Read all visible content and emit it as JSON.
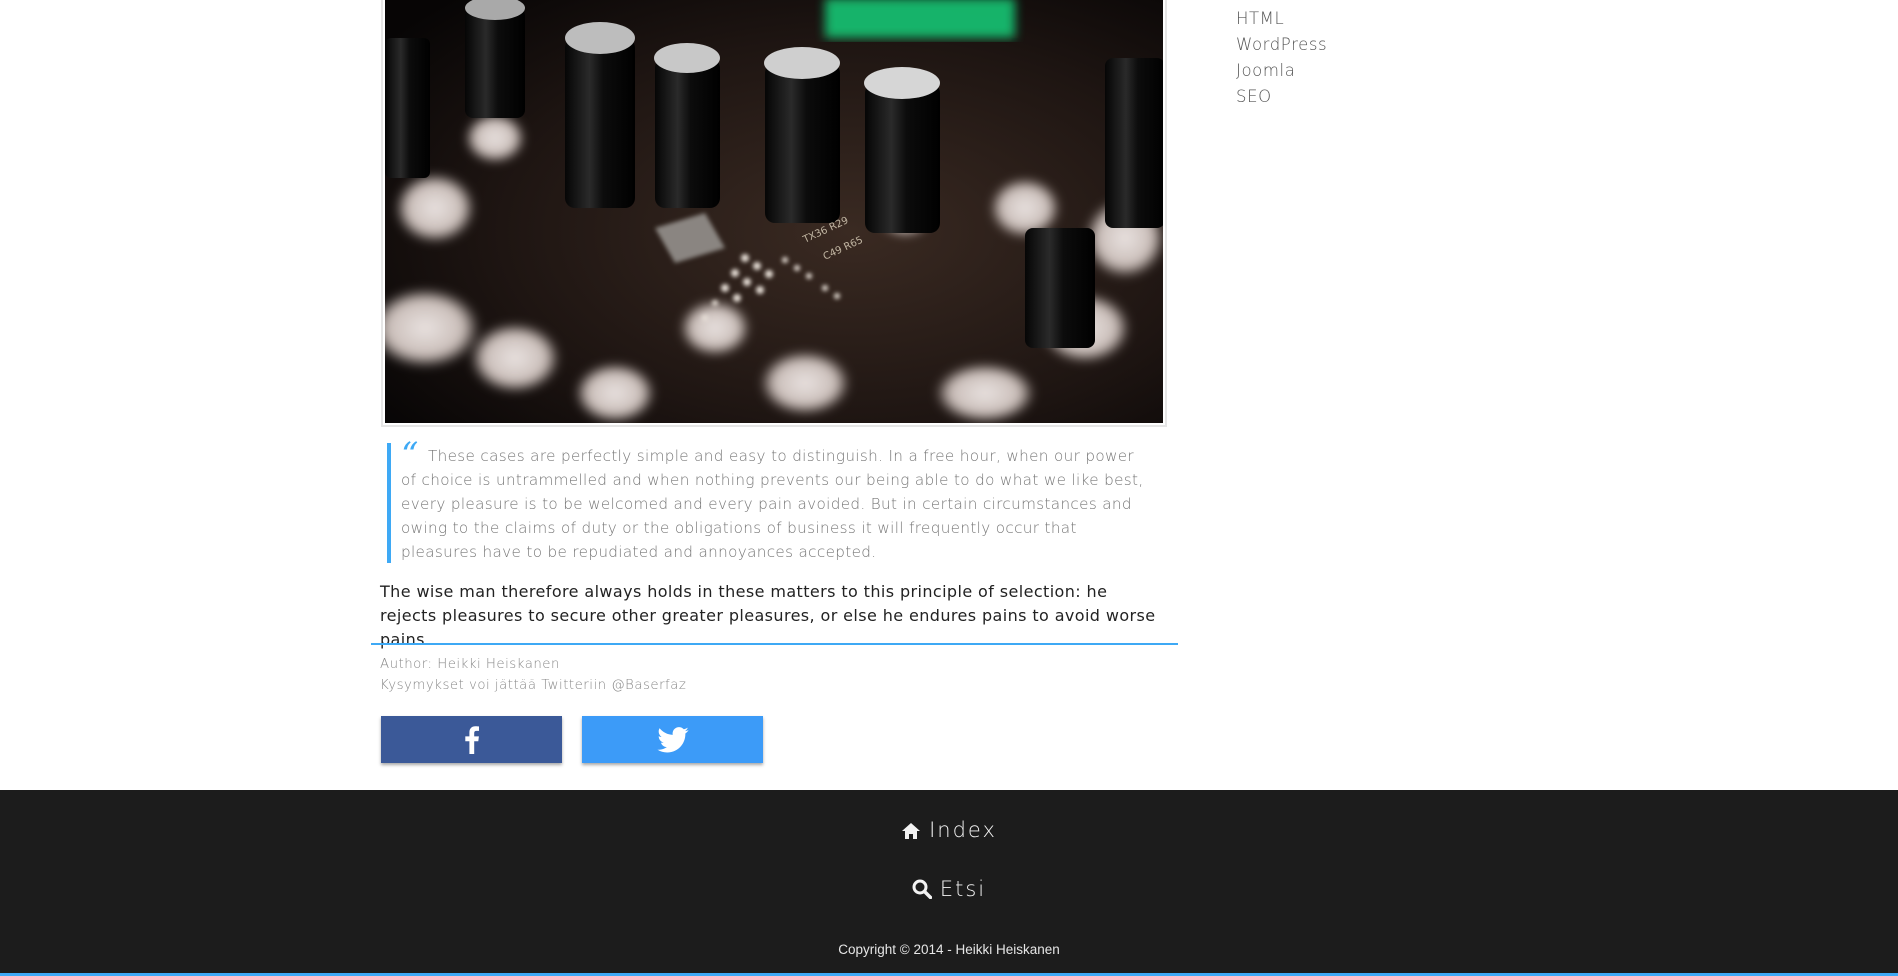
{
  "hero_image": {
    "subject": "circuit-board-photo"
  },
  "sidebar": {
    "links": [
      {
        "label": "HTML"
      },
      {
        "label": "WordPress"
      },
      {
        "label": "Joomla"
      },
      {
        "label": "SEO"
      }
    ]
  },
  "article": {
    "quote_mark": "“",
    "quote": "These cases are perfectly simple and easy to distinguish. In a free hour, when our power of choice is untrammelled and when nothing prevents our being able to do what we like best, every pleasure is to be welcomed and every pain avoided. But in certain circumstances and owing to the claims of duty or the obligations of business it will frequently occur that pleasures have to be repudiated and annoyances accepted.",
    "lead": "The wise man therefore always holds in these matters to this principle of selection: he rejects pleasures to secure other greater pleasures, or else he endures pains to avoid worse pains.",
    "author": "Author: Heikki Heiskanen",
    "twitter_note": "Kysymykset voi jättää Twitteriin @Baserfaz"
  },
  "share": {
    "facebook_icon": "facebook-icon",
    "twitter_icon": "twitter-icon",
    "facebook_color": "#3b5998",
    "twitter_color": "#3c9bf8"
  },
  "footer": {
    "index_label": "Index",
    "index_icon": "home-icon",
    "search_label": "Etsi",
    "search_icon": "search-icon",
    "copyright": "Copyright © 2014 - Heikki Heiskanen"
  },
  "colors": {
    "accent": "#3ea9f5",
    "footer_bg": "#1c1c1c"
  }
}
